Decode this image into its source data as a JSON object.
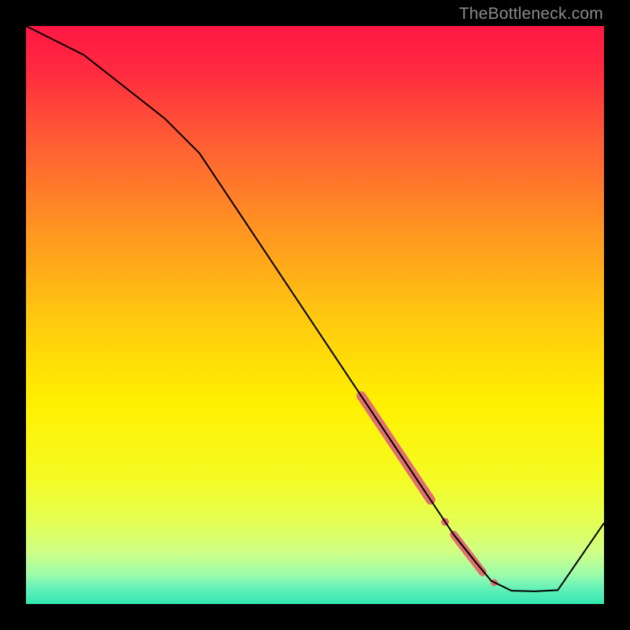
{
  "watermark": "TheBottleneck.com",
  "chart_data": {
    "type": "line",
    "title": "",
    "xlabel": "",
    "ylabel": "",
    "xlim": [
      0,
      100
    ],
    "ylim": [
      0,
      100
    ],
    "grid": false,
    "background_gradient": {
      "stops": [
        {
          "offset": 0.0,
          "color": "#ff1744"
        },
        {
          "offset": 0.08,
          "color": "#ff2b3f"
        },
        {
          "offset": 0.2,
          "color": "#ff5d34"
        },
        {
          "offset": 0.35,
          "color": "#ff9421"
        },
        {
          "offset": 0.5,
          "color": "#ffc710"
        },
        {
          "offset": 0.65,
          "color": "#fff000"
        },
        {
          "offset": 0.78,
          "color": "#f5fb22"
        },
        {
          "offset": 0.86,
          "color": "#e3ff55"
        },
        {
          "offset": 0.91,
          "color": "#d0ff85"
        },
        {
          "offset": 0.95,
          "color": "#9afcac"
        },
        {
          "offset": 0.975,
          "color": "#5ff0b8"
        },
        {
          "offset": 1.0,
          "color": "#34e6b0"
        }
      ]
    },
    "series": [
      {
        "name": "curve",
        "color": "#000000",
        "stroke_width": 2,
        "x": [
          0,
          10,
          24,
          30,
          40,
          50,
          58,
          64,
          70,
          74,
          78,
          80.5,
          84,
          88,
          92,
          100
        ],
        "y": [
          100,
          95,
          84,
          78,
          63,
          48,
          36,
          27,
          18,
          12,
          7,
          4,
          2.3,
          2.2,
          2.4,
          14
        ]
      }
    ],
    "markers": [
      {
        "name": "highlight-segment-1",
        "type": "thick-segment",
        "color": "#e06f6f",
        "width": 12,
        "x": [
          58,
          70
        ],
        "y": [
          36,
          18
        ]
      },
      {
        "name": "highlight-dot-1",
        "type": "dot",
        "color": "#e06f6f",
        "r": 5,
        "x": 72.5,
        "y": 14.2
      },
      {
        "name": "highlight-segment-2",
        "type": "thick-segment",
        "color": "#e06f6f",
        "width": 10,
        "x": [
          74,
          79
        ],
        "y": [
          12,
          5.5
        ]
      },
      {
        "name": "highlight-dot-2",
        "type": "dot",
        "color": "#e06f6f",
        "r": 4.5,
        "x": 81,
        "y": 3.7
      }
    ]
  }
}
